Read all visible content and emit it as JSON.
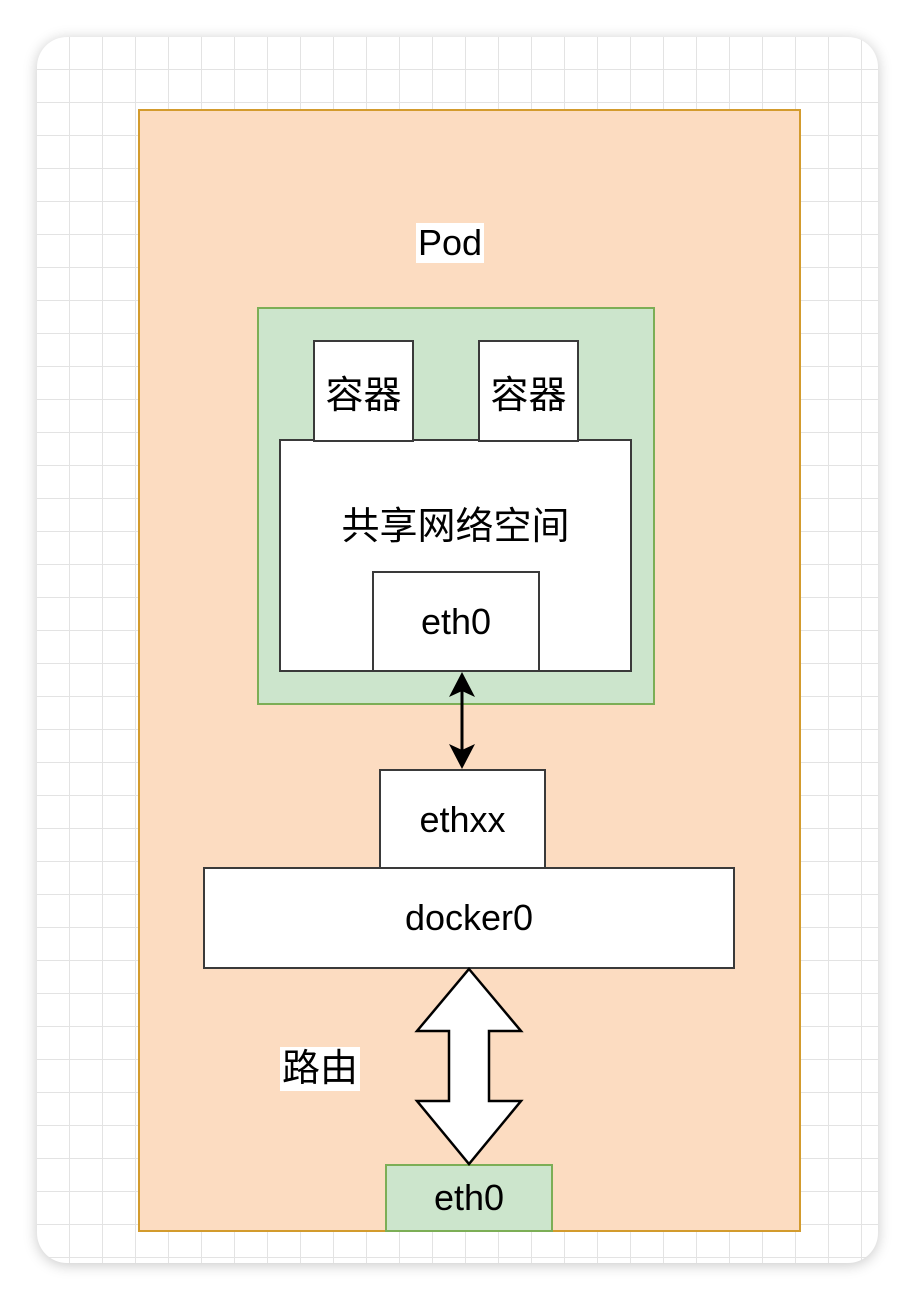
{
  "diagram": {
    "pod_label": "Pod",
    "containers": [
      "容器",
      "容器"
    ],
    "shared_netns_label": "共享网络空间",
    "pod_eth0_label": "eth0",
    "veth_label": "ethxx",
    "bridge_label": "docker0",
    "route_label": "路由",
    "host_eth0_label": "eth0"
  },
  "colors": {
    "pod_fill": "#fcdcc1",
    "pod_border": "#d39b2d",
    "green_fill": "#cce5cc",
    "green_border": "#7cae56",
    "box_border": "#3a3a3a"
  }
}
